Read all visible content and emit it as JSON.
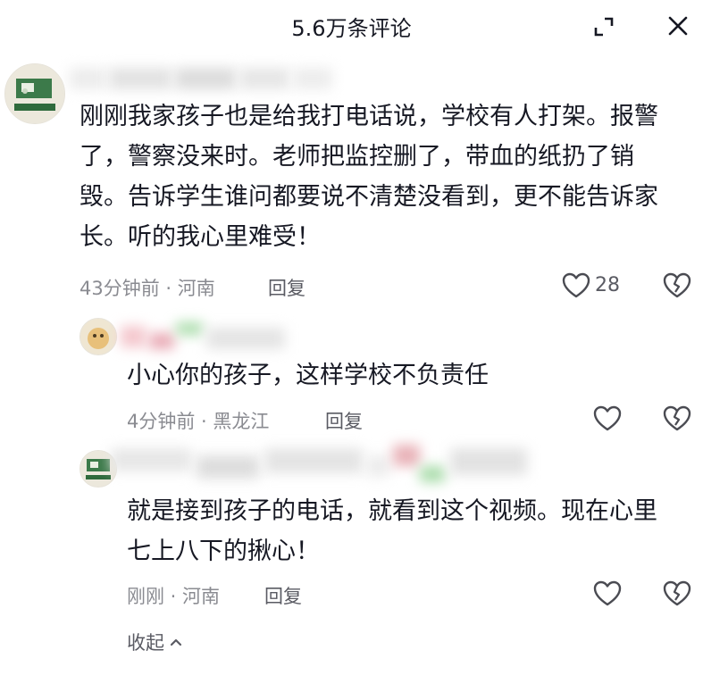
{
  "header": {
    "title": "5.6万条评论",
    "expand_icon": "expand-icon",
    "close_icon": "close-icon"
  },
  "comments": [
    {
      "text_lines": [
        "刚刚我家孩子也是给我打电话说，学校有人打架。报警",
        "了，警察没来时。老师把监控删了，带血的纸扔了销",
        "毁。告诉学生谁问都要说不清楚没看到，更不能告诉家",
        "长。听的我心里难受！"
      ],
      "meta": "43分钟前 · 河南",
      "reply_label": "回复",
      "like_count": "28"
    }
  ],
  "replies": [
    {
      "text_lines": [
        "小心你的孩子，这样学校不负责任"
      ],
      "meta": "4分钟前 · 黑龙江",
      "reply_label": "回复"
    },
    {
      "text_lines": [
        "就是接到孩子的电话，就看到这个视频。现在心里",
        "七上八下的揪心！"
      ],
      "meta": "刚刚 · 河南",
      "reply_label": "回复"
    }
  ],
  "collapse_label": "收起",
  "colors": {
    "text": "#161823",
    "meta": "#8a8b91",
    "icon": "#4a4b52"
  }
}
